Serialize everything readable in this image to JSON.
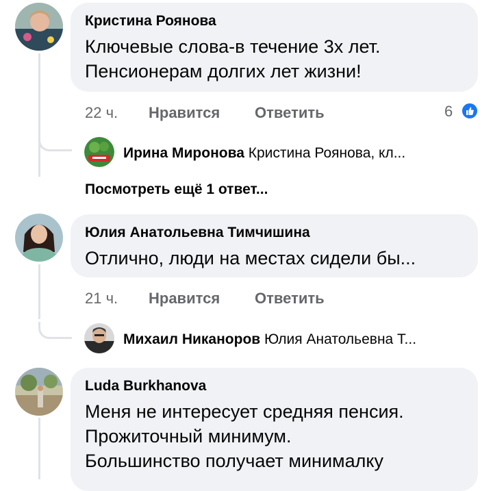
{
  "comments": [
    {
      "author": "Кристина Роянова",
      "lines": [
        "Ключевые слова-в течение 3х лет.",
        "Пенсионерам долгих лет жизни!"
      ],
      "time": "22 ч.",
      "like_label": "Нравится",
      "reply_label": "Ответить",
      "reaction_count": "6",
      "reaction_icon": "like-icon",
      "replies": [
        {
          "author": "Ирина Миронова",
          "preview": "Кристина Роянова, кл..."
        }
      ],
      "more_replies": "Посмотреть ещё 1 ответ..."
    },
    {
      "author": "Юлия Анатольевна Тимчишина",
      "lines": [
        "Отлично, люди на местах сидели бы..."
      ],
      "time": "21 ч.",
      "like_label": "Нравится",
      "reply_label": "Ответить",
      "replies": [
        {
          "author": "Михаил Никаноров",
          "preview": "Юлия Анатольевна Т..."
        }
      ]
    },
    {
      "author": "Luda Burkhanova",
      "lines": [
        "Меня не интересует средняя пенсия.",
        "Прожиточный минимум.",
        "Большинство  получает минималку"
      ]
    }
  ],
  "colors": {
    "bubble": "#f0f2f5",
    "meta_text": "#65676b",
    "like_blue": "#1877f2",
    "thread_line": "#e0e2e6"
  }
}
